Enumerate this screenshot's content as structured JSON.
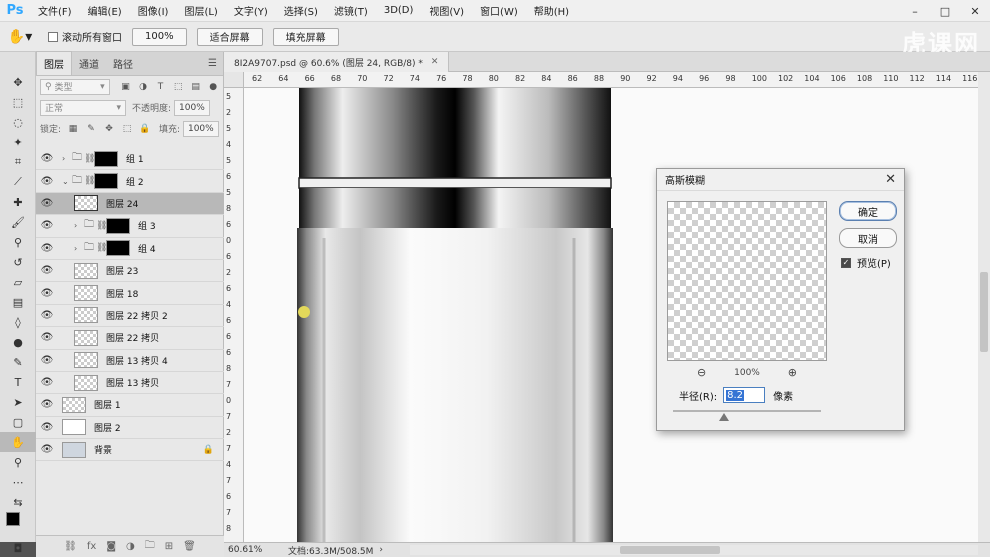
{
  "app": {
    "logo": "Ps",
    "menus": [
      "文件(F)",
      "编辑(E)",
      "图像(I)",
      "图层(L)",
      "文字(Y)",
      "选择(S)",
      "滤镜(T)",
      "3D(D)",
      "视图(V)",
      "窗口(W)",
      "帮助(H)"
    ],
    "window_buttons": [
      "–",
      "□",
      "✕"
    ],
    "watermark": "虎课网"
  },
  "options_bar": {
    "scroll_all_windows": "滚动所有窗口",
    "zoom_100": "100%",
    "fit_screen": "适合屏幕",
    "fill_screen": "填充屏幕"
  },
  "layers_panel": {
    "tabs": [
      "图层",
      "通道",
      "路径"
    ],
    "filter_placeholder": "类型",
    "blend_mode": "正常",
    "opacity_label": "不透明度:",
    "opacity_value": "100%",
    "lock_label": "锁定:",
    "fill_label": "填充:",
    "fill_value": "100%",
    "layers": [
      {
        "name": "组 1",
        "type": "group",
        "expanded": false,
        "indent": 0
      },
      {
        "name": "组 2",
        "type": "group",
        "expanded": true,
        "indent": 0
      },
      {
        "name": "图层 24",
        "type": "layer",
        "selected": true,
        "indent": 1
      },
      {
        "name": "组 3",
        "type": "group",
        "expanded": false,
        "indent": 1
      },
      {
        "name": "组 4",
        "type": "group",
        "expanded": false,
        "indent": 1
      },
      {
        "name": "图层 23",
        "type": "layer",
        "indent": 1
      },
      {
        "name": "图层 18",
        "type": "layer",
        "indent": 1
      },
      {
        "name": "图层 22 拷贝 2",
        "type": "layer",
        "indent": 1
      },
      {
        "name": "图层 22 拷贝",
        "type": "layer",
        "indent": 1
      },
      {
        "name": "图层 13 拷贝 4",
        "type": "layer",
        "indent": 1
      },
      {
        "name": "图层 13 拷贝",
        "type": "layer",
        "indent": 1
      },
      {
        "name": "图层 1",
        "type": "layer",
        "indent": 0
      },
      {
        "name": "图层 2",
        "type": "layer",
        "indent": 0
      },
      {
        "name": "背景",
        "type": "background",
        "locked": true,
        "indent": 0
      }
    ]
  },
  "document": {
    "tab_title": "8I2A9707.psd @ 60.6% (图层 24, RGB/8) *",
    "ruler_h": [
      "62",
      "64",
      "66",
      "68",
      "70",
      "72",
      "74",
      "76",
      "78",
      "80",
      "82",
      "84",
      "86",
      "88",
      "90",
      "92",
      "94",
      "96",
      "98",
      "100",
      "102",
      "104",
      "106",
      "108",
      "110",
      "112",
      "114",
      "116"
    ],
    "ruler_v": [
      "5",
      "2",
      "5",
      "4",
      "5",
      "6",
      "5",
      "8",
      "6",
      "0",
      "6",
      "2",
      "6",
      "4",
      "6",
      "6",
      "6",
      "8",
      "7",
      "0",
      "7",
      "2",
      "7",
      "4",
      "7",
      "6",
      "7",
      "8"
    ],
    "zoom": "60.61%",
    "doc_info": "文档:63.3M/508.5M"
  },
  "dialog": {
    "title": "高斯模糊",
    "ok": "确定",
    "cancel": "取消",
    "preview_label": "预览(P)",
    "preview_checked": true,
    "zoom_percent": "100%",
    "radius_label": "半径(R):",
    "radius_value": "8.2",
    "unit": "像素"
  },
  "colors": {
    "accent": "#31a8ff",
    "selection_highlight": "#3574d4"
  }
}
